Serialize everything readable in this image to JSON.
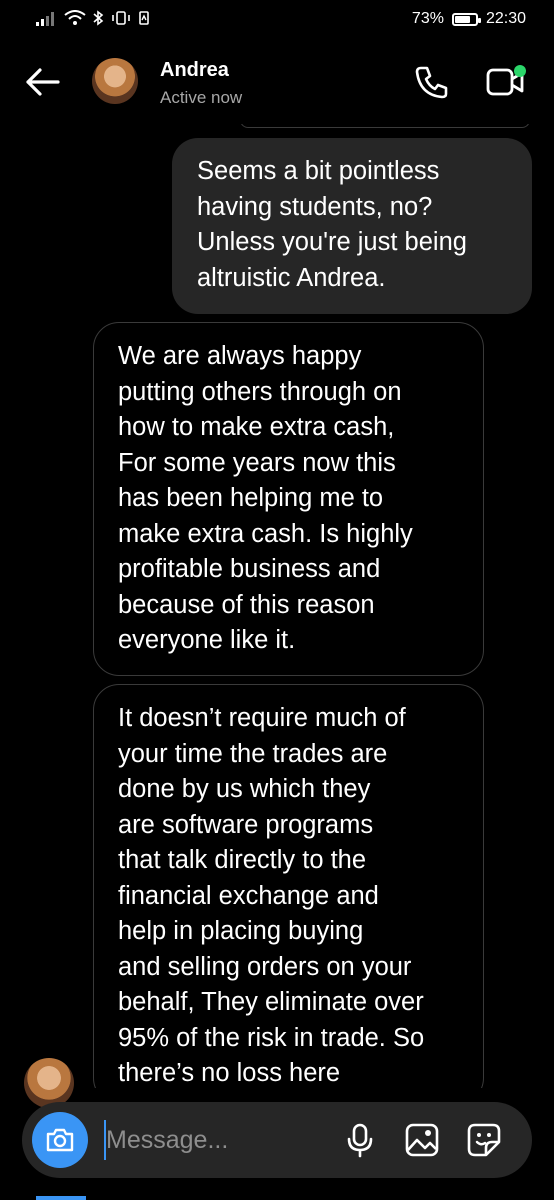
{
  "status_bar": {
    "battery": "73%",
    "battery_level": 0.73,
    "time": "22:30"
  },
  "header": {
    "name": "Andrea",
    "status": "Active now"
  },
  "messages": [
    {
      "direction": "outgoing",
      "text": "Seems a bit pointless\nhaving students, no?\nUnless you're just being\naltruistic Andrea."
    },
    {
      "direction": "incoming",
      "text": "We are always happy\nputting others through on\nhow to make extra cash,\nFor some years now this\nhas been helping me to\nmake extra cash. Is highly\nprofitable business and\nbecause of this reason\neveryone like it."
    },
    {
      "direction": "incoming",
      "text": "It doesn’t require much of\nyour time the trades are\ndone by us which they\nare software programs\nthat talk directly to the\nfinancial exchange and\nhelp in placing buying\nand selling orders on your\nbehalf, They eliminate over\n95% of the risk in trade. So\nthere’s no loss here"
    }
  ],
  "composer": {
    "placeholder": "Message..."
  },
  "colors": {
    "accent": "#3a95f5",
    "bubble_out": "#262626",
    "online": "#2bd66a"
  },
  "icons": [
    "back-arrow-icon",
    "phone-icon",
    "video-call-icon",
    "camera-icon",
    "microphone-icon",
    "gallery-icon",
    "sticker-icon"
  ]
}
